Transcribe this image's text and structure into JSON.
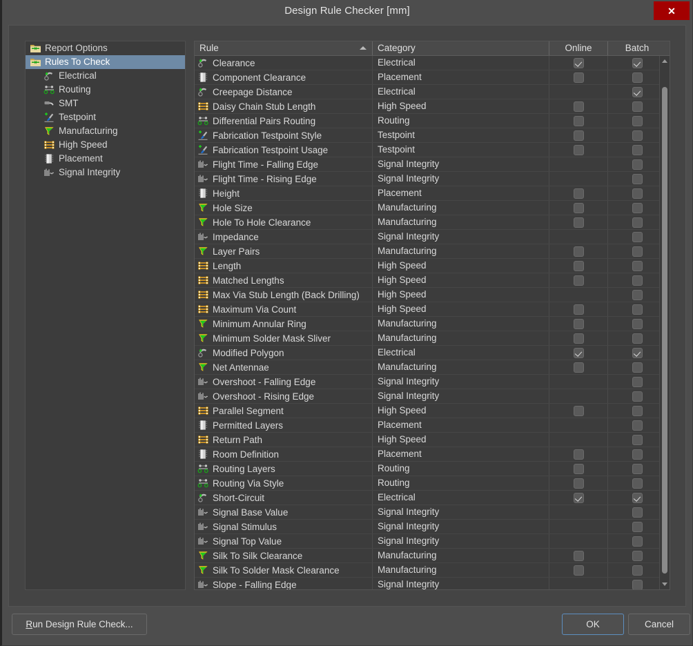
{
  "window": {
    "title": "Design Rule Checker [mm]",
    "close_label": "✕"
  },
  "sidebar": {
    "items": [
      {
        "label": "Report Options",
        "icon": "folder-rules-icon",
        "level": "root",
        "selected": false
      },
      {
        "label": "Rules To Check",
        "icon": "folder-rules-icon",
        "level": "root",
        "selected": true
      },
      {
        "label": "Electrical",
        "icon": "electrical-icon",
        "level": "child",
        "selected": false
      },
      {
        "label": "Routing",
        "icon": "routing-icon",
        "level": "child",
        "selected": false
      },
      {
        "label": "SMT",
        "icon": "smt-icon",
        "level": "child",
        "selected": false
      },
      {
        "label": "Testpoint",
        "icon": "testpoint-icon",
        "level": "child",
        "selected": false
      },
      {
        "label": "Manufacturing",
        "icon": "manufacturing-icon",
        "level": "child",
        "selected": false
      },
      {
        "label": "High Speed",
        "icon": "highspeed-icon",
        "level": "child",
        "selected": false
      },
      {
        "label": "Placement",
        "icon": "placement-icon",
        "level": "child",
        "selected": false
      },
      {
        "label": "Signal Integrity",
        "icon": "signalintegrity-icon",
        "level": "child",
        "selected": false
      }
    ]
  },
  "table": {
    "columns": [
      {
        "key": "rule",
        "label": "Rule",
        "sort": "asc"
      },
      {
        "key": "category",
        "label": "Category",
        "sort": null
      },
      {
        "key": "online",
        "label": "Online",
        "sort": null
      },
      {
        "key": "batch",
        "label": "Batch",
        "sort": null
      }
    ],
    "rows": [
      {
        "rule": "Clearance",
        "category": "Electrical",
        "icon": "electrical-icon",
        "online": true,
        "batch": true,
        "online_present": true,
        "batch_present": true
      },
      {
        "rule": "Component Clearance",
        "category": "Placement",
        "icon": "placement-icon",
        "online": false,
        "batch": false,
        "online_present": true,
        "batch_present": true
      },
      {
        "rule": "Creepage Distance",
        "category": "Electrical",
        "icon": "electrical-icon",
        "online": false,
        "batch": true,
        "online_present": false,
        "batch_present": true
      },
      {
        "rule": "Daisy Chain Stub Length",
        "category": "High Speed",
        "icon": "highspeed-icon",
        "online": false,
        "batch": false,
        "online_present": true,
        "batch_present": true
      },
      {
        "rule": "Differential Pairs Routing",
        "category": "Routing",
        "icon": "routing-icon",
        "online": false,
        "batch": false,
        "online_present": true,
        "batch_present": true
      },
      {
        "rule": "Fabrication Testpoint Style",
        "category": "Testpoint",
        "icon": "testpoint-icon",
        "online": false,
        "batch": false,
        "online_present": true,
        "batch_present": true
      },
      {
        "rule": "Fabrication Testpoint Usage",
        "category": "Testpoint",
        "icon": "testpoint-icon",
        "online": false,
        "batch": false,
        "online_present": true,
        "batch_present": true
      },
      {
        "rule": "Flight Time - Falling Edge",
        "category": "Signal Integrity",
        "icon": "signalintegrity-icon",
        "online": false,
        "batch": false,
        "online_present": false,
        "batch_present": true
      },
      {
        "rule": "Flight Time - Rising Edge",
        "category": "Signal Integrity",
        "icon": "signalintegrity-icon",
        "online": false,
        "batch": false,
        "online_present": false,
        "batch_present": true
      },
      {
        "rule": "Height",
        "category": "Placement",
        "icon": "placement-icon",
        "online": false,
        "batch": false,
        "online_present": true,
        "batch_present": true
      },
      {
        "rule": "Hole Size",
        "category": "Manufacturing",
        "icon": "manufacturing-icon",
        "online": false,
        "batch": false,
        "online_present": true,
        "batch_present": true
      },
      {
        "rule": "Hole To Hole Clearance",
        "category": "Manufacturing",
        "icon": "manufacturing-icon",
        "online": false,
        "batch": false,
        "online_present": true,
        "batch_present": true
      },
      {
        "rule": "Impedance",
        "category": "Signal Integrity",
        "icon": "signalintegrity-icon",
        "online": false,
        "batch": false,
        "online_present": false,
        "batch_present": true
      },
      {
        "rule": "Layer Pairs",
        "category": "Manufacturing",
        "icon": "manufacturing-icon",
        "online": false,
        "batch": false,
        "online_present": true,
        "batch_present": true
      },
      {
        "rule": "Length",
        "category": "High Speed",
        "icon": "highspeed-icon",
        "online": false,
        "batch": false,
        "online_present": true,
        "batch_present": true
      },
      {
        "rule": "Matched Lengths",
        "category": "High Speed",
        "icon": "highspeed-icon",
        "online": false,
        "batch": false,
        "online_present": true,
        "batch_present": true
      },
      {
        "rule": "Max Via Stub Length (Back Drilling)",
        "category": "High Speed",
        "icon": "highspeed-icon",
        "online": false,
        "batch": false,
        "online_present": false,
        "batch_present": true
      },
      {
        "rule": "Maximum Via Count",
        "category": "High Speed",
        "icon": "highspeed-icon",
        "online": false,
        "batch": false,
        "online_present": true,
        "batch_present": true
      },
      {
        "rule": "Minimum Annular Ring",
        "category": "Manufacturing",
        "icon": "manufacturing-icon",
        "online": false,
        "batch": false,
        "online_present": true,
        "batch_present": true
      },
      {
        "rule": "Minimum Solder Mask Sliver",
        "category": "Manufacturing",
        "icon": "manufacturing-icon",
        "online": false,
        "batch": false,
        "online_present": true,
        "batch_present": true
      },
      {
        "rule": "Modified Polygon",
        "category": "Electrical",
        "icon": "electrical-icon",
        "online": true,
        "batch": true,
        "online_present": true,
        "batch_present": true
      },
      {
        "rule": "Net Antennae",
        "category": "Manufacturing",
        "icon": "manufacturing-icon",
        "online": false,
        "batch": false,
        "online_present": true,
        "batch_present": true
      },
      {
        "rule": "Overshoot - Falling Edge",
        "category": "Signal Integrity",
        "icon": "signalintegrity-icon",
        "online": false,
        "batch": false,
        "online_present": false,
        "batch_present": true
      },
      {
        "rule": "Overshoot - Rising Edge",
        "category": "Signal Integrity",
        "icon": "signalintegrity-icon",
        "online": false,
        "batch": false,
        "online_present": false,
        "batch_present": true
      },
      {
        "rule": "Parallel Segment",
        "category": "High Speed",
        "icon": "highspeed-icon",
        "online": false,
        "batch": false,
        "online_present": true,
        "batch_present": true
      },
      {
        "rule": "Permitted Layers",
        "category": "Placement",
        "icon": "placement-icon",
        "online": false,
        "batch": false,
        "online_present": false,
        "batch_present": true
      },
      {
        "rule": "Return Path",
        "category": "High Speed",
        "icon": "highspeed-icon",
        "online": false,
        "batch": false,
        "online_present": false,
        "batch_present": true
      },
      {
        "rule": "Room Definition",
        "category": "Placement",
        "icon": "placement-icon",
        "online": false,
        "batch": false,
        "online_present": true,
        "batch_present": true
      },
      {
        "rule": "Routing Layers",
        "category": "Routing",
        "icon": "routing-icon",
        "online": false,
        "batch": false,
        "online_present": true,
        "batch_present": true
      },
      {
        "rule": "Routing Via Style",
        "category": "Routing",
        "icon": "routing-icon",
        "online": false,
        "batch": false,
        "online_present": true,
        "batch_present": true
      },
      {
        "rule": "Short-Circuit",
        "category": "Electrical",
        "icon": "electrical-icon",
        "online": true,
        "batch": true,
        "online_present": true,
        "batch_present": true
      },
      {
        "rule": "Signal Base Value",
        "category": "Signal Integrity",
        "icon": "signalintegrity-icon",
        "online": false,
        "batch": false,
        "online_present": false,
        "batch_present": true
      },
      {
        "rule": "Signal Stimulus",
        "category": "Signal Integrity",
        "icon": "signalintegrity-icon",
        "online": false,
        "batch": false,
        "online_present": false,
        "batch_present": true
      },
      {
        "rule": "Signal Top Value",
        "category": "Signal Integrity",
        "icon": "signalintegrity-icon",
        "online": false,
        "batch": false,
        "online_present": false,
        "batch_present": true
      },
      {
        "rule": "Silk To Silk Clearance",
        "category": "Manufacturing",
        "icon": "manufacturing-icon",
        "online": false,
        "batch": false,
        "online_present": true,
        "batch_present": true
      },
      {
        "rule": "Silk To Solder Mask Clearance",
        "category": "Manufacturing",
        "icon": "manufacturing-icon",
        "online": false,
        "batch": false,
        "online_present": true,
        "batch_present": true
      },
      {
        "rule": "Slope - Falling Edge",
        "category": "Signal Integrity",
        "icon": "signalintegrity-icon",
        "online": false,
        "batch": false,
        "online_present": false,
        "batch_present": true
      }
    ]
  },
  "footer": {
    "run_accel": "R",
    "run_rest": "un Design Rule Check...",
    "ok_label": "OK",
    "cancel_label": "Cancel"
  },
  "colors": {
    "dialog_bg": "#4d4d4d",
    "panel_bg": "#444444",
    "list_bg": "#3c3c3c",
    "selection": "#6e8aa6",
    "close_red": "#a30000",
    "focus_blue": "#5d8fc0",
    "text": "#d9d9d9"
  }
}
